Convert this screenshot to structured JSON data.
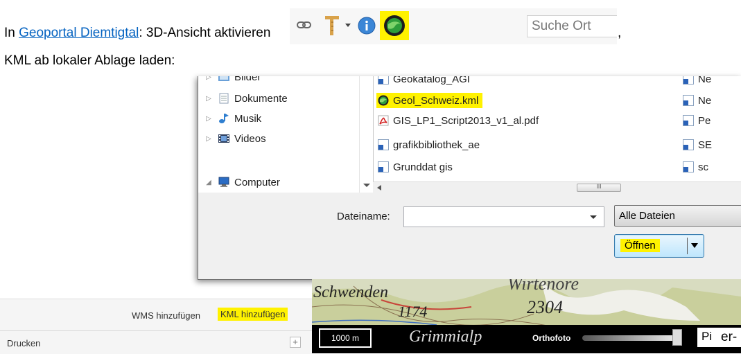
{
  "doc": {
    "prefix": "In ",
    "link": "Geoportal Diemtigtal",
    "suffix": ": 3D-Ansicht aktivieren",
    "comma": ",",
    "line2": "KML ab lokaler Ablage laden:",
    "trailing": "er-"
  },
  "toolbar": {
    "search_placeholder": "Suche Ort"
  },
  "dialog": {
    "tree": [
      {
        "label": "Bilder",
        "icon": "pictures-folder-icon"
      },
      {
        "label": "Dokumente",
        "icon": "documents-folder-icon"
      },
      {
        "label": "Musik",
        "icon": "music-folder-icon"
      },
      {
        "label": "Videos",
        "icon": "videos-folder-icon"
      },
      {
        "label": "Computer",
        "icon": "computer-icon"
      }
    ],
    "files": [
      {
        "label": "Geokatalog_AGI",
        "icon": "shortcut-icon"
      },
      {
        "label": "Geol_Schweiz.kml",
        "icon": "kml-file-icon"
      },
      {
        "label": "GIS_LP1_Script2013_v1_al.pdf",
        "icon": "pdf-file-icon"
      },
      {
        "label": "grafikbibliothek_ae",
        "icon": "shortcut-icon"
      },
      {
        "label": "Grunddat gis",
        "icon": "shortcut-icon"
      }
    ],
    "files_col2": [
      "Ne",
      "Ne",
      "Pe",
      "SE",
      "sc"
    ],
    "filename_label": "Dateiname:",
    "filename_value": "",
    "filetype_value": "Alle Dateien",
    "open_button": "Öffnen",
    "scroll_glyph": "III"
  },
  "map": {
    "labels": [
      "Schwenden",
      "1174",
      "Wirtenore",
      "2304",
      "Grimmialp"
    ],
    "scale": "1000 m",
    "orthofoto": "Orthofoto",
    "pi": "Pi"
  },
  "leftpanel": {
    "wms": "WMS hinzufügen",
    "kml": "KML hinzufügen",
    "drucken": "Drucken",
    "plus": "+"
  },
  "colors": {
    "highlight": "#fff200",
    "link": "#0563c1"
  }
}
